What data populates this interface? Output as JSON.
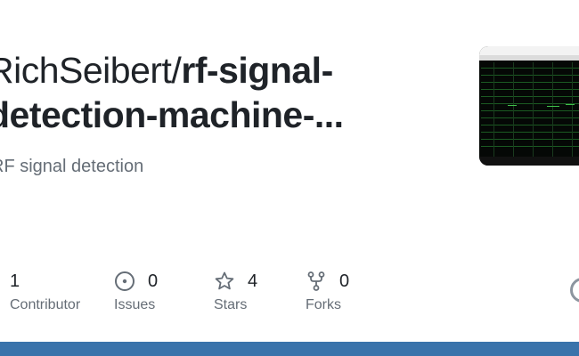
{
  "repo": {
    "owner": "RichSeibert/",
    "name_line1": "rf-signal-",
    "name_line2": "detection-machine-...",
    "description": "RF signal detection"
  },
  "stats": {
    "contributors": {
      "value": "1",
      "label": "Contributor"
    },
    "issues": {
      "value": "0",
      "label": "Issues",
      "icon": "issue-opened-icon"
    },
    "stars": {
      "value": "4",
      "label": "Stars",
      "icon": "star-icon"
    },
    "forks": {
      "value": "0",
      "label": "Forks",
      "icon": "repo-forked-icon"
    }
  },
  "colors": {
    "accent_bar": "#3a73ab",
    "text": "#1f2328",
    "muted": "#656d76"
  }
}
